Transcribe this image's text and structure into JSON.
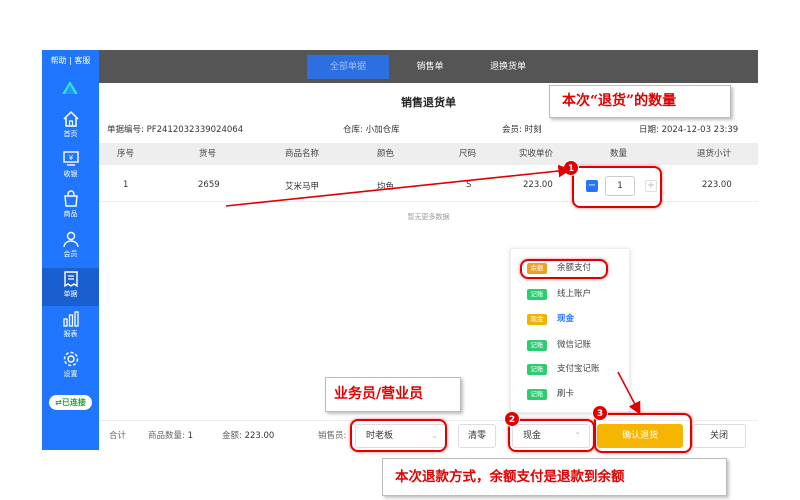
{
  "sidebar": {
    "help_text": "帮助 | 客服",
    "items": [
      {
        "label": "首页",
        "icon": "home-icon"
      },
      {
        "label": "收银",
        "icon": "cashier-icon"
      },
      {
        "label": "商品",
        "icon": "bag-icon"
      },
      {
        "label": "会员",
        "icon": "member-icon"
      },
      {
        "label": "单据",
        "icon": "receipt-icon"
      },
      {
        "label": "报表",
        "icon": "chart-icon"
      },
      {
        "label": "设置",
        "icon": "gear-icon"
      }
    ],
    "active_item": "单据",
    "status": "已连接"
  },
  "tabs": [
    {
      "label": "全部单据",
      "active": true
    },
    {
      "label": "销售单",
      "active": false
    },
    {
      "label": "退换货单",
      "active": false
    }
  ],
  "dialog": {
    "title": "销售退货单",
    "order_no_label": "单据编号:",
    "order_no": "PF2412032339024064",
    "warehouse_label": "仓库:",
    "warehouse": "小加仓库",
    "member_label": "会员:",
    "member": "时刻",
    "date_label": "日期:",
    "date": "2024-12-03 23:39"
  },
  "table": {
    "columns": [
      "序号",
      "货号",
      "商品名称",
      "颜色",
      "尺码",
      "实收单价",
      "数量",
      "退货小计"
    ],
    "rows": [
      {
        "index": "1",
        "sku": "2659",
        "name": "艾米马甲",
        "color": "均色",
        "size": "S",
        "price": "223.00",
        "qty": "1",
        "subtotal": "223.00"
      }
    ],
    "no_more": "暂无更多数据"
  },
  "payment_options": [
    {
      "badge": "余额",
      "label": "余额支付",
      "badge_color": "#f0a020"
    },
    {
      "badge": "记账",
      "label": "线上账户",
      "badge_color": "#2ecc71"
    },
    {
      "badge": "现金",
      "label": "现金",
      "badge_color": "#f0b400",
      "selected": true
    },
    {
      "badge": "记账",
      "label": "微信记账",
      "badge_color": "#2ecc71"
    },
    {
      "badge": "记账",
      "label": "支付宝记账",
      "badge_color": "#2ecc71"
    },
    {
      "badge": "记账",
      "label": "刷卡",
      "badge_color": "#2ecc71"
    }
  ],
  "footer": {
    "total_label": "合计",
    "qty_label": "商品数量:",
    "qty_value": "1",
    "amount_label": "金额:",
    "amount_value": "223.00",
    "seller_label": "销售员:",
    "seller_value": "时老板",
    "clear_label": "清零",
    "payment_value": "现金",
    "confirm_label": "确认退货",
    "close_label": "关闭"
  },
  "annotations": {
    "qty_note": "本次“退货”的数量",
    "seller_note": "业务员/营业员",
    "payment_note": "本次退款方式，余额支付是退款到余额",
    "step1": "1",
    "step2": "2",
    "step3": "3"
  },
  "colors": {
    "sidebar_bg": "#2176ff",
    "confirm_btn": "#f6b500",
    "annotation_red": "#e00000"
  }
}
